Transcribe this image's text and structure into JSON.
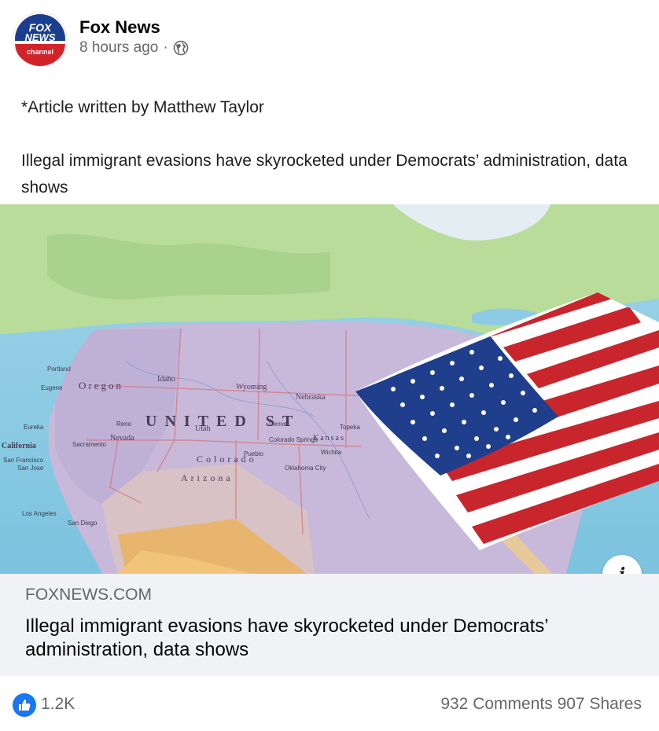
{
  "header": {
    "page_name": "Fox News",
    "time": "8 hours ago",
    "separator": "·",
    "avatar_logo": {
      "line1": "FOX",
      "line2": "NEWS",
      "line3": "channel"
    }
  },
  "post": {
    "byline": "*Article written by Matthew Taylor",
    "body": "Illegal immigrant evasions have skyrocketed under Democrats’ administration, data shows"
  },
  "link_preview": {
    "map_labels": {
      "country": "UNITED ST",
      "states": [
        "Oregon",
        "Idaho",
        "Nevada",
        "Utah",
        "Colorado",
        "Wyoming",
        "Nebraska",
        "Kansas",
        "California",
        "Arizona"
      ],
      "cities": [
        "Portland",
        "Eugene",
        "Sacramento",
        "San Jose",
        "San Francisco",
        "Los Angeles",
        "San Diego",
        "Denver",
        "Colorado Springs",
        "Topeka",
        "Wichita",
        "Oklahoma City",
        "Reno",
        "Eureka",
        "Pueblo"
      ]
    },
    "domain": "FOXNEWS.COM",
    "title": "Illegal immigrant evasions have skyrocketed under Democrats’ administration, data shows",
    "info_label": "i"
  },
  "stats": {
    "likes": "1.2K",
    "comments": "932 Comments",
    "shares": "907 Shares"
  },
  "colors": {
    "brand_blue": "#1877f2",
    "muted_text": "#65676b",
    "footer_bg": "#f0f2f5",
    "fox_blue": "#1b3f8f",
    "fox_red": "#d2232a"
  },
  "icons": {
    "audience": "globe-icon",
    "reaction": "like-icon",
    "info": "info-icon"
  }
}
